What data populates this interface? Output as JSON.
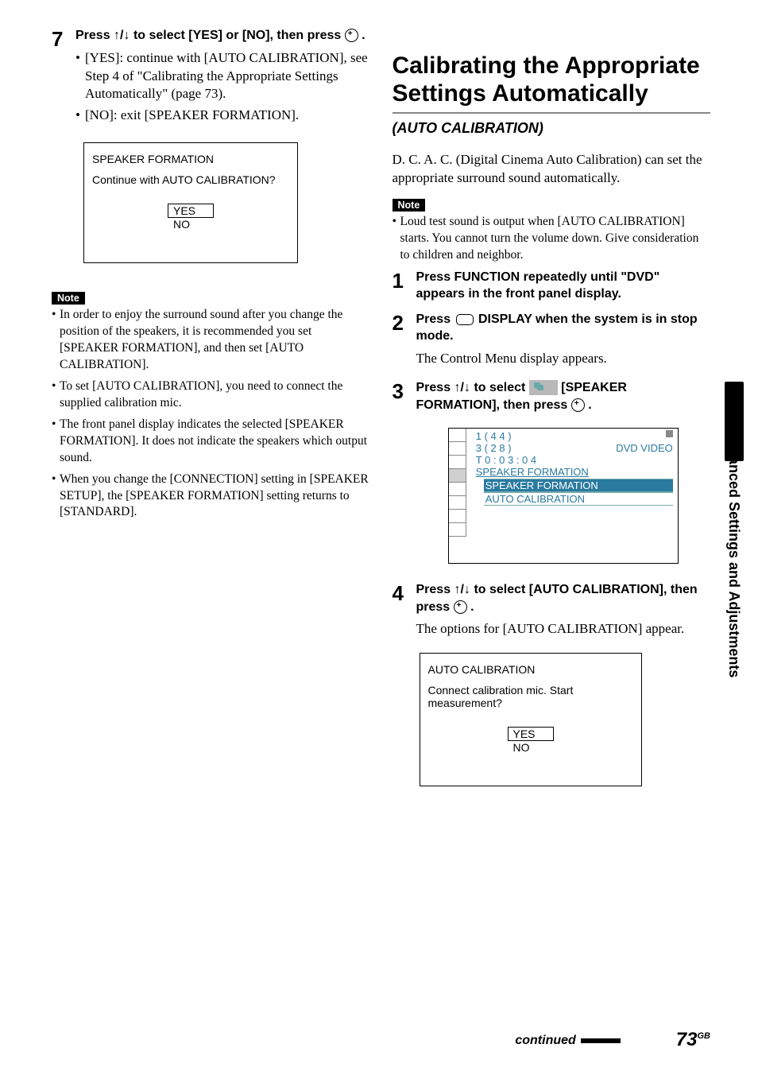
{
  "left": {
    "step7_num": "7",
    "step7_head_a": "Press ",
    "step7_arrows": "↑/↓",
    "step7_head_b": " to select [YES] or [NO], then press ",
    "step7_head_c": " .",
    "bullet1": "[YES]: continue with [AUTO CALIBRATION], see Step 4 of \"Calibrating the Appropriate Settings Automatically\" (page 73).",
    "bullet2": "[NO]: exit [SPEAKER FORMATION].",
    "osd": {
      "title": "SPEAKER FORMATION",
      "question": "Continue with AUTO CALIBRATION?",
      "yes": "YES",
      "no": "NO"
    },
    "note_label": "Note",
    "notes": [
      "In order to enjoy the surround sound after you change the position of the speakers, it is recommended you set [SPEAKER FORMATION], and then set [AUTO CALIBRATION].",
      "To set [AUTO CALIBRATION], you need to connect the supplied calibration mic.",
      "The front panel display indicates the selected [SPEAKER FORMATION]. It does not indicate the speakers which output sound.",
      "When you change the [CONNECTION] setting in [SPEAKER SETUP], the [SPEAKER FORMATION] setting returns to [STANDARD]."
    ]
  },
  "right": {
    "heading": "Calibrating the Appropriate Settings Automatically",
    "subhead": "(AUTO CALIBRATION)",
    "intro": "D. C. A. C. (Digital Cinema Auto Calibration) can set the appropriate surround sound automatically.",
    "note_label": "Note",
    "note_text": "Loud test sound is output when [AUTO CALIBRATION] starts. You cannot turn the volume down. Give consideration to children and neighbor.",
    "steps": {
      "s1_num": "1",
      "s1_text": "Press FUNCTION repeatedly until \"DVD\" appears in the front panel display.",
      "s2_num": "2",
      "s2_a": "Press ",
      "s2_b": " DISPLAY when the system is in stop mode.",
      "s2_after": "The Control Menu display appears.",
      "s3_num": "3",
      "s3_a": "Press ",
      "s3_arrows": "↑/↓",
      "s3_b": " to select ",
      "s3_c": " [SPEAKER FORMATION], then press ",
      "s3_d": " .",
      "s4_num": "4",
      "s4_a": "Press ",
      "s4_arrows": "↑/↓",
      "s4_b": " to select [AUTO CALIBRATION], then press ",
      "s4_c": " .",
      "s4_after": "The options for [AUTO CALIBRATION] appear."
    },
    "menu": {
      "line1": "1 ( 4 4 )",
      "line2": "3 ( 2 8 )",
      "line2_right": "DVD VIDEO",
      "line3": "T     0 : 0 3 : 0 4",
      "line4": "SPEAKER FORMATION",
      "opt1": "SPEAKER FORMATION",
      "opt2": "AUTO CALIBRATION"
    },
    "osd2": {
      "title": "AUTO CALIBRATION",
      "question": "Connect calibration mic. Start measurement?",
      "yes": "YES",
      "no": "NO"
    }
  },
  "sidebar_label": "Advanced Settings and Adjustments",
  "footer": {
    "continued": "continued",
    "page_num": "73",
    "page_suffix": "GB"
  }
}
